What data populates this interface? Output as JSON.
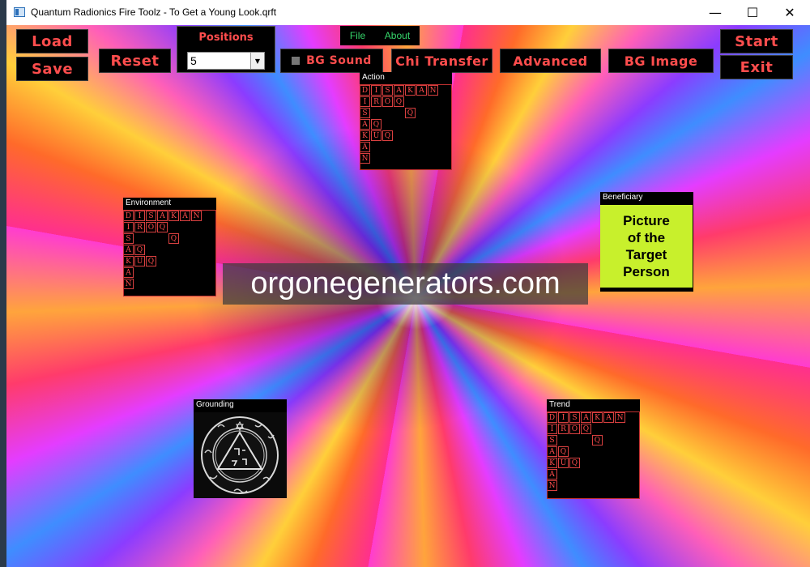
{
  "window": {
    "title": "Quantum Radionics Fire Toolz - To Get a Young Look.qrft",
    "minimize": "—",
    "maximize": "☐",
    "close": "✕"
  },
  "toolbar": {
    "load": "Load",
    "save": "Save",
    "reset": "Reset",
    "positions_label": "Positions",
    "positions_value": "5",
    "bg_sound": "BG Sound",
    "chi_transfer": "Chi Transfer",
    "advanced": "Advanced",
    "bg_image": "BG Image",
    "start": "Start",
    "exit": "Exit"
  },
  "menu": {
    "file": "File",
    "about": "About"
  },
  "grid_rows": [
    [
      "D",
      "I",
      "S",
      "A",
      "K",
      "A",
      "N"
    ],
    [
      "I",
      "R",
      "O",
      "Q"
    ],
    [
      "S",
      "",
      "",
      "",
      "Q"
    ],
    [
      "A",
      "Q"
    ],
    [
      "K",
      "U",
      "Q"
    ],
    [
      "A"
    ],
    [
      "N"
    ]
  ],
  "panels": {
    "action": "Action",
    "environment": "Environment",
    "beneficiary": "Beneficiary",
    "grounding": "Grounding",
    "trend": "Trend"
  },
  "beneficiary_picture": {
    "line1": "Picture",
    "line2": "of the",
    "line3": "Target",
    "line4": "Person"
  },
  "watermark": "orgonegenerators.com",
  "colors": {
    "button_text": "#ff4d4d",
    "menu_text": "#36d66b",
    "picture_bg": "#c8f02c"
  }
}
